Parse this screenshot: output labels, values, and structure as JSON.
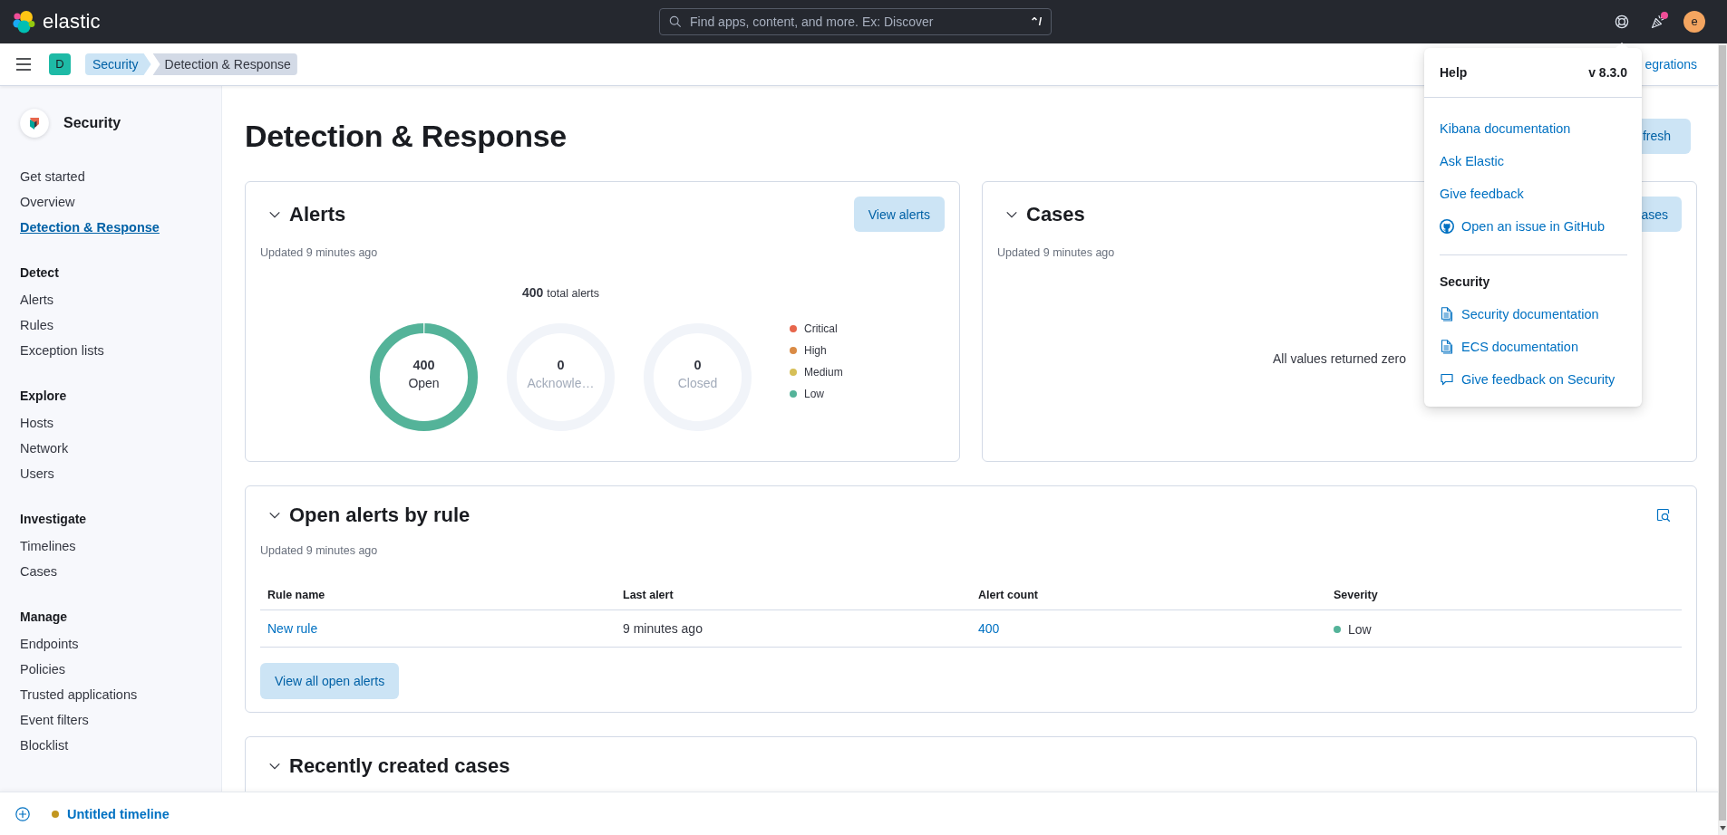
{
  "top_bar": {
    "logo_text": "elastic",
    "search": {
      "placeholder": "Find apps, content, and more. Ex: Discover",
      "shortcut": "⌃/"
    },
    "notifications_unread": true,
    "avatar_initial": "e"
  },
  "nav_bar": {
    "space_initial": "D",
    "breadcrumbs": [
      {
        "label": "Security",
        "current": false
      },
      {
        "label": "Detection & Response",
        "current": true
      }
    ],
    "link": "egrations"
  },
  "sidebar": {
    "title": "Security",
    "groups": [
      {
        "items": [
          {
            "label": "Get started",
            "selected": false
          },
          {
            "label": "Overview",
            "selected": false
          },
          {
            "label": "Detection & Response",
            "selected": true
          }
        ]
      },
      {
        "heading": "Detect",
        "items": [
          {
            "label": "Alerts",
            "selected": false
          },
          {
            "label": "Rules",
            "selected": false
          },
          {
            "label": "Exception lists",
            "selected": false
          }
        ]
      },
      {
        "heading": "Explore",
        "items": [
          {
            "label": "Hosts",
            "selected": false
          },
          {
            "label": "Network",
            "selected": false
          },
          {
            "label": "Users",
            "selected": false
          }
        ]
      },
      {
        "heading": "Investigate",
        "items": [
          {
            "label": "Timelines",
            "selected": false
          },
          {
            "label": "Cases",
            "selected": false
          }
        ]
      },
      {
        "heading": "Manage",
        "items": [
          {
            "label": "Endpoints",
            "selected": false
          },
          {
            "label": "Policies",
            "selected": false
          },
          {
            "label": "Trusted applications",
            "selected": false
          },
          {
            "label": "Event filters",
            "selected": false
          },
          {
            "label": "Blocklist",
            "selected": false
          }
        ]
      }
    ]
  },
  "page": {
    "title": "Detection & Response",
    "refresh_button": "fresh"
  },
  "alerts_panel": {
    "title": "Alerts",
    "button": "View alerts",
    "updated": "Updated 9 minutes ago",
    "total_count": "400",
    "total_label": "total alerts",
    "donuts": [
      {
        "count": "400",
        "label": "Open",
        "empty": false,
        "color": "#54b399"
      },
      {
        "count": "0",
        "label": "Acknowle…",
        "empty": true
      },
      {
        "count": "0",
        "label": "Closed",
        "empty": true
      }
    ],
    "legend": [
      {
        "label": "Critical",
        "color": "#e7664c"
      },
      {
        "label": "High",
        "color": "#da8b45"
      },
      {
        "label": "Medium",
        "color": "#d6bf57"
      },
      {
        "label": "Low",
        "color": "#54b399"
      }
    ]
  },
  "cases_panel": {
    "title": "Cases",
    "button": "ases",
    "updated": "Updated 9 minutes ago",
    "message": "All values returned zero"
  },
  "rules_panel": {
    "title": "Open alerts by rule",
    "updated": "Updated 9 minutes ago",
    "table": {
      "columns": [
        "Rule name",
        "Last alert",
        "Alert count",
        "Severity"
      ],
      "rows": [
        {
          "rule_name": "New rule",
          "last_alert": "9 minutes ago",
          "alert_count": "400",
          "severity": "Low",
          "color": "#54b399"
        }
      ]
    },
    "button": "View all open alerts"
  },
  "recent_cases_panel": {
    "title": "Recently created cases"
  },
  "help_menu": {
    "title": "Help",
    "version": "v 8.3.0",
    "links": [
      {
        "label": "Kibana documentation",
        "kind": "plain"
      },
      {
        "label": "Ask Elastic",
        "kind": "plain"
      },
      {
        "label": "Give feedback",
        "kind": "plain"
      },
      {
        "label": "Open an issue in GitHub",
        "kind": "github"
      }
    ],
    "section": {
      "title": "Security",
      "links": [
        {
          "label": "Security documentation",
          "kind": "document"
        },
        {
          "label": "ECS documentation",
          "kind": "document"
        },
        {
          "label": "Give feedback on Security",
          "kind": "feedback"
        }
      ]
    }
  },
  "timeline_bar": {
    "title": "Untitled timeline"
  }
}
